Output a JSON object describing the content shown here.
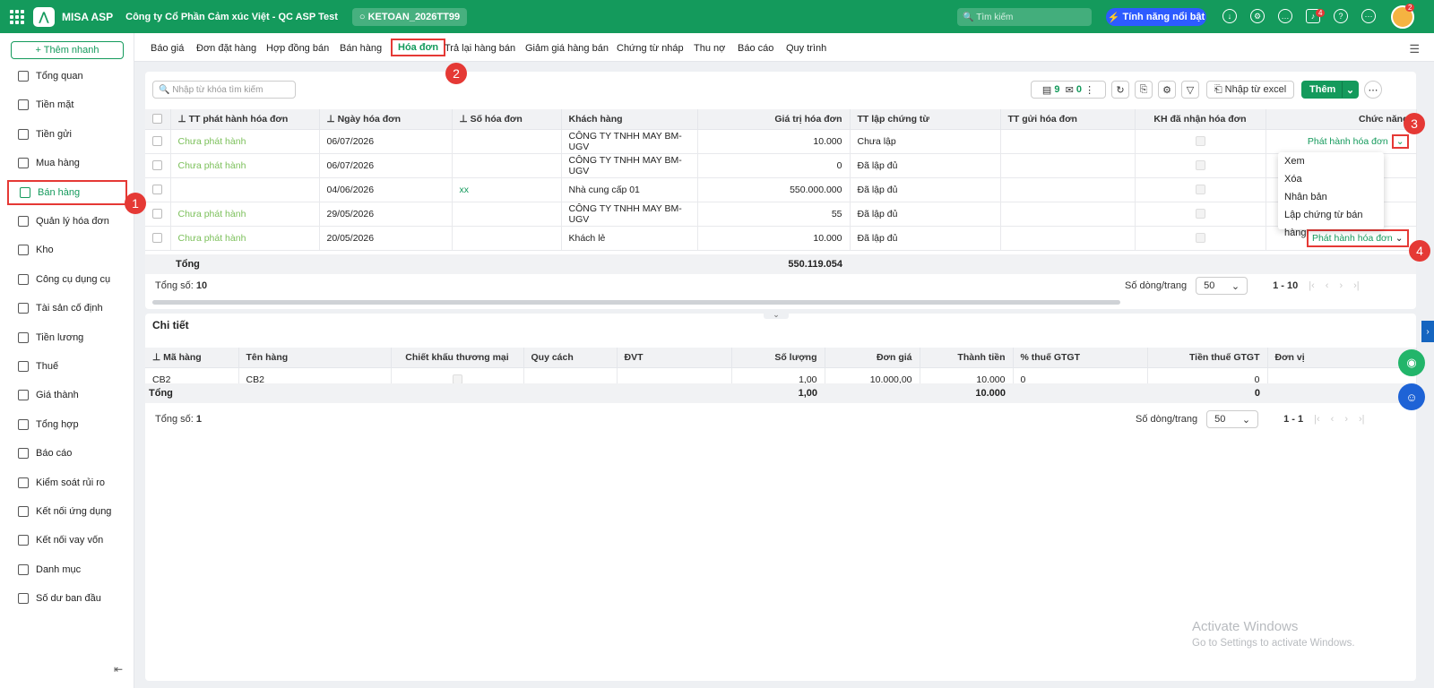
{
  "top": {
    "brand": "MISA ASP",
    "company": "Công ty Cổ Phần Cảm xúc Việt - QC ASP Test",
    "db": "KETOAN_2026TT99",
    "search_placeholder": "Tìm kiếm",
    "feature": "Tính năng nổi bật",
    "bell_badge": "4",
    "avatar_badge": "2",
    "color": "#149a5c"
  },
  "sidebar": {
    "add": "+ Thêm nhanh",
    "items": [
      "Tổng quan",
      "Tiền mặt",
      "Tiền gửi",
      "Mua hàng",
      "Bán hàng",
      "Quản lý hóa đơn",
      "Kho",
      "Công cụ dụng cụ",
      "Tài sản cố định",
      "Tiền lương",
      "Thuế",
      "Giá thành",
      "Tổng hợp",
      "Báo cáo",
      "Kiểm soát rủi ro",
      "Kết nối ứng dụng",
      "Kết nối vay vốn",
      "Danh mục",
      "Số dư ban đầu"
    ],
    "active": "Bán hàng"
  },
  "tabs": [
    "Báo giá",
    "Đơn đặt hàng",
    "Hợp đồng bán",
    "Bán hàng",
    "Hóa đơn",
    "Trả lại hàng bán",
    "Giảm giá hàng bán",
    "Chứng từ nháp",
    "Thu nợ",
    "Báo cáo",
    "Quy trình"
  ],
  "toolbar": {
    "search_placeholder": "Nhập từ khóa tìm kiếm",
    "count_doc": "9",
    "count_mail": "0",
    "import": "Nhập từ excel",
    "add": "Thêm"
  },
  "grid": {
    "headers": [
      "TT phát hành hóa đơn",
      "Ngày hóa đơn",
      "Số hóa đơn",
      "Khách hàng",
      "Giá trị hóa đơn",
      "TT lập chứng từ",
      "TT gửi hóa đơn",
      "KH đã nhận hóa đơn",
      "Chức năng"
    ],
    "rows": [
      {
        "status": "Chưa phát hành",
        "date": "06/07/2026",
        "no": "",
        "customer": "CÔNG TY TNHH MAY BM-UGV",
        "value": "10.000",
        "doc": "Chưa lập",
        "action": "Phát hành hóa đơn"
      },
      {
        "status": "Chưa phát hành",
        "date": "06/07/2026",
        "no": "",
        "customer": "CÔNG TY TNHH MAY BM-UGV",
        "value": "0",
        "doc": "Đã lập đủ",
        "action": ""
      },
      {
        "status": "",
        "date": "04/06/2026",
        "no": "xx",
        "customer": "Nhà cung cấp 01",
        "value": "550.000.000",
        "doc": "Đã lập đủ",
        "action": ""
      },
      {
        "status": "Chưa phát hành",
        "date": "29/05/2026",
        "no": "",
        "customer": "CÔNG TY TNHH MAY BM-UGV",
        "value": "55",
        "doc": "Đã lập đủ",
        "action": ""
      },
      {
        "status": "Chưa phát hành",
        "date": "20/05/2026",
        "no": "",
        "customer": "Khách lẻ",
        "value": "10.000",
        "doc": "Đã lập đủ",
        "action": "Phát hành hóa đơn"
      }
    ],
    "total_label": "Tổng",
    "total_value": "550.119.054",
    "count_label": "Tổng số:",
    "count": "10",
    "page_size_label": "Số dòng/trang",
    "page_size": "50",
    "range": "1 - 10"
  },
  "dropdown": [
    "Xem",
    "Xóa",
    "Nhân bản",
    "Lập chứng từ bán hàng"
  ],
  "markers": [
    "1",
    "2",
    "3",
    "4"
  ],
  "detail": {
    "title": "Chi tiết",
    "headers": [
      "Mã hàng",
      "Tên hàng",
      "Chiết khấu thương mại",
      "Quy cách",
      "ĐVT",
      "Số lượng",
      "Đơn giá",
      "Thành tiền",
      "% thuế GTGT",
      "Tiền thuế GTGT",
      "Đơn vị"
    ],
    "row": {
      "code": "CB2",
      "name": "CB2",
      "qty": "1,00",
      "price": "10.000,00",
      "amount": "10.000",
      "vat": "0",
      "vat_amount": "0"
    },
    "total_label": "Tổng",
    "total_qty": "1,00",
    "total_amount": "10.000",
    "total_vat": "0",
    "count_label": "Tổng số:",
    "count": "1",
    "page_size_label": "Số dòng/trang",
    "page_size": "50",
    "range": "1 - 1"
  },
  "watermark": {
    "line1": "Activate Windows",
    "line2": "Go to Settings to activate Windows."
  }
}
